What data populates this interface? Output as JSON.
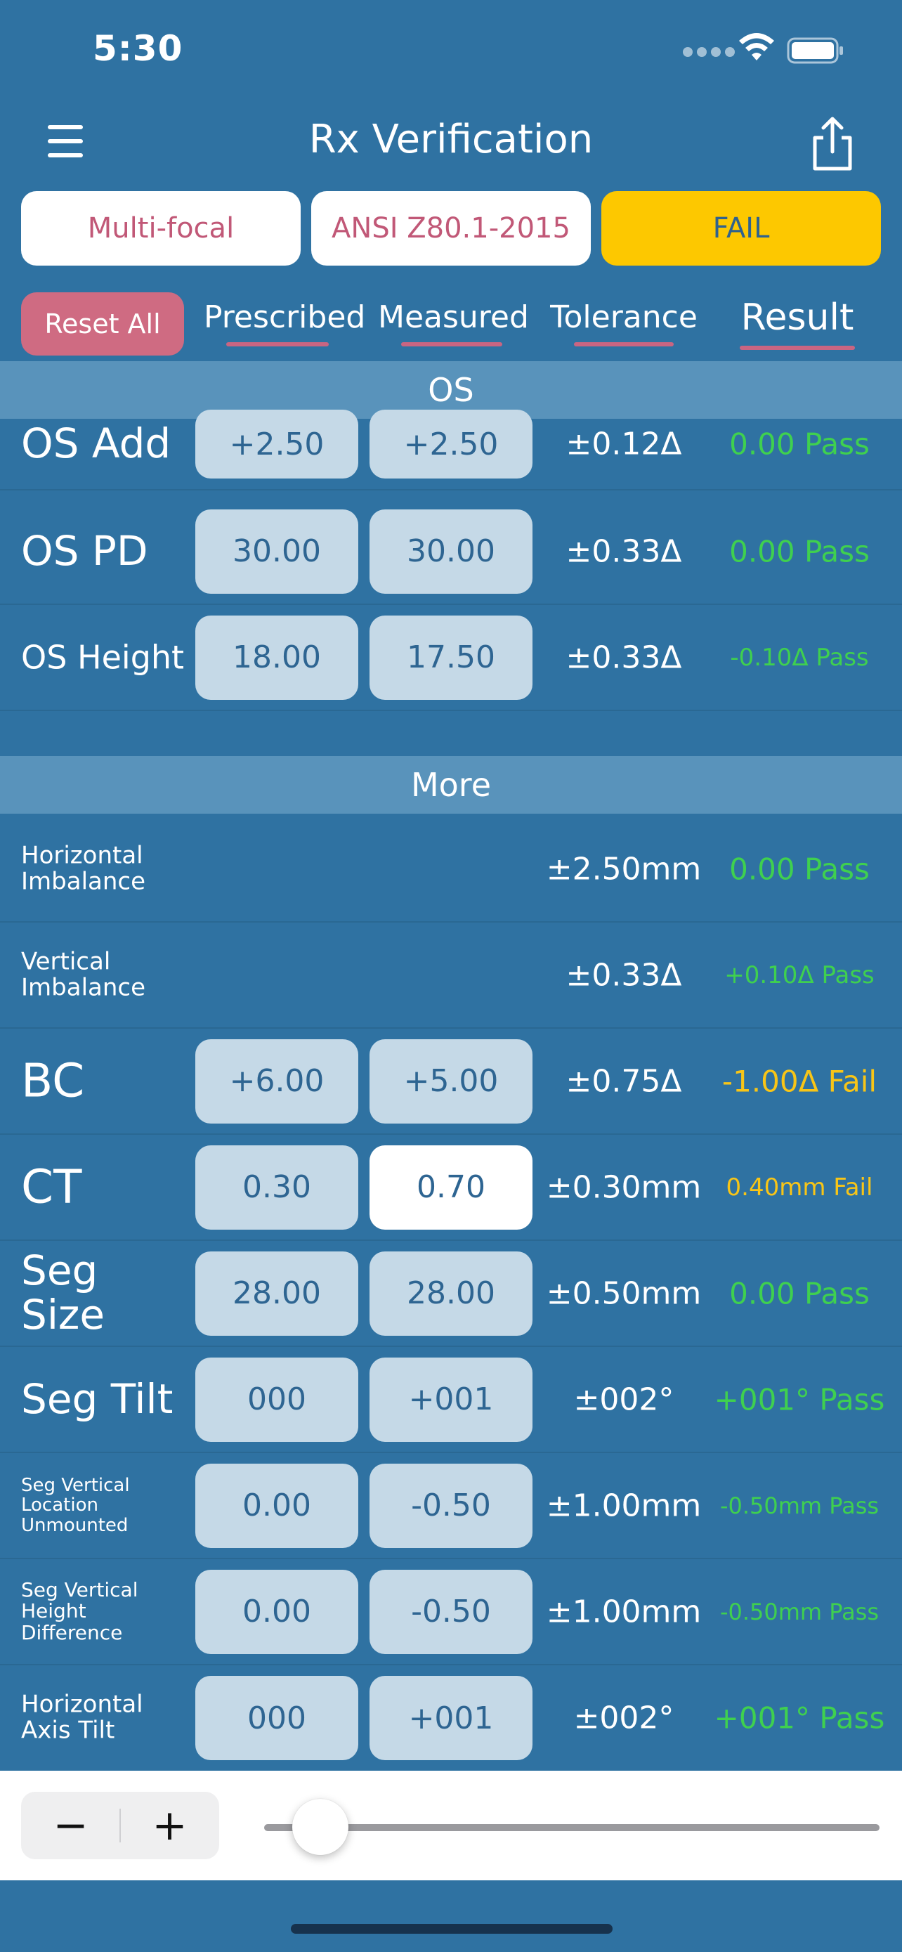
{
  "status_bar": {
    "time": "5:30"
  },
  "header": {
    "title": "Rx Verification"
  },
  "pills": {
    "lens_type": "Multi-focal",
    "standard": "ANSI Z80.1-2015",
    "result": "FAIL"
  },
  "columns": {
    "reset": "Reset All",
    "prescribed": "Prescribed",
    "measured": "Measured",
    "tolerance": "Tolerance",
    "result": "Result"
  },
  "sections": {
    "os": "OS",
    "more": "More"
  },
  "os_rows": [
    {
      "label": "OS Add",
      "prescribed": "+2.50",
      "measured": "+2.50",
      "tolerance": "±0.12Δ",
      "result": "0.00 Pass"
    },
    {
      "label": "OS PD",
      "prescribed": "30.00",
      "measured": "30.00",
      "tolerance": "±0.33Δ",
      "result": "0.00 Pass"
    },
    {
      "label": "OS Height",
      "prescribed": "18.00",
      "measured": "17.50",
      "tolerance": "±0.33Δ",
      "result": "-0.10Δ Pass"
    }
  ],
  "more_rows": [
    {
      "label": "Horizontal Imbalance",
      "tolerance": "±2.50mm",
      "result": "0.00 Pass"
    },
    {
      "label": "Vertical Imbalance",
      "tolerance": "±0.33Δ",
      "result": "+0.10Δ Pass"
    },
    {
      "label": "BC",
      "prescribed": "+6.00",
      "measured": "+5.00",
      "tolerance": "±0.75Δ",
      "result": "-1.00Δ Fail"
    },
    {
      "label": "CT",
      "prescribed": "0.30",
      "measured": "0.70",
      "tolerance": "±0.30mm",
      "result": "0.40mm Fail"
    },
    {
      "label": "Seg Size",
      "prescribed": "28.00",
      "measured": "28.00",
      "tolerance": "±0.50mm",
      "result": "0.00 Pass"
    },
    {
      "label": "Seg Tilt",
      "prescribed": "000",
      "measured": "+001",
      "tolerance": "±002°",
      "result": "+001° Pass"
    },
    {
      "label": "Seg Vertical Location Unmounted",
      "prescribed": "0.00",
      "measured": "-0.50",
      "tolerance": "±1.00mm",
      "result": "-0.50mm Pass"
    },
    {
      "label": "Seg Vertical Height Difference",
      "prescribed": "0.00",
      "measured": "-0.50",
      "tolerance": "±1.00mm",
      "result": "-0.50mm Pass"
    },
    {
      "label": "Horizontal Axis Tilt",
      "prescribed": "000",
      "measured": "+001",
      "tolerance": "±002°",
      "result": "+001° Pass"
    }
  ],
  "bottom_bar": {
    "minus": "−",
    "plus": "+",
    "slider_value": 0.05
  },
  "colors": {
    "background": "#2f72a2",
    "section": "#5993bb",
    "cell": "#c5d9e7",
    "pass": "#3fd04f",
    "fail": "#f8c517",
    "fail_pill": "#fdc800",
    "accent_pink": "#c15877"
  }
}
